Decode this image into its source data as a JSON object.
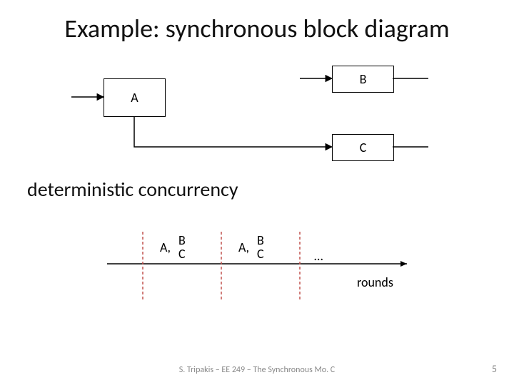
{
  "title": "Example: synchronous block diagram",
  "subtitle": "deterministic concurrency",
  "blocks": {
    "A": "A",
    "B": "B",
    "C": "C"
  },
  "timeline": {
    "round1": {
      "A": "A,",
      "B": "B",
      "C": "C"
    },
    "round2": {
      "A": "A,",
      "B": "B",
      "C": "C"
    },
    "dots": "…",
    "caption": "rounds"
  },
  "footer": "S. Tripakis – EE 249 – The Synchronous Mo. C",
  "page": "5",
  "colors": {
    "tick": "#c0504d"
  }
}
